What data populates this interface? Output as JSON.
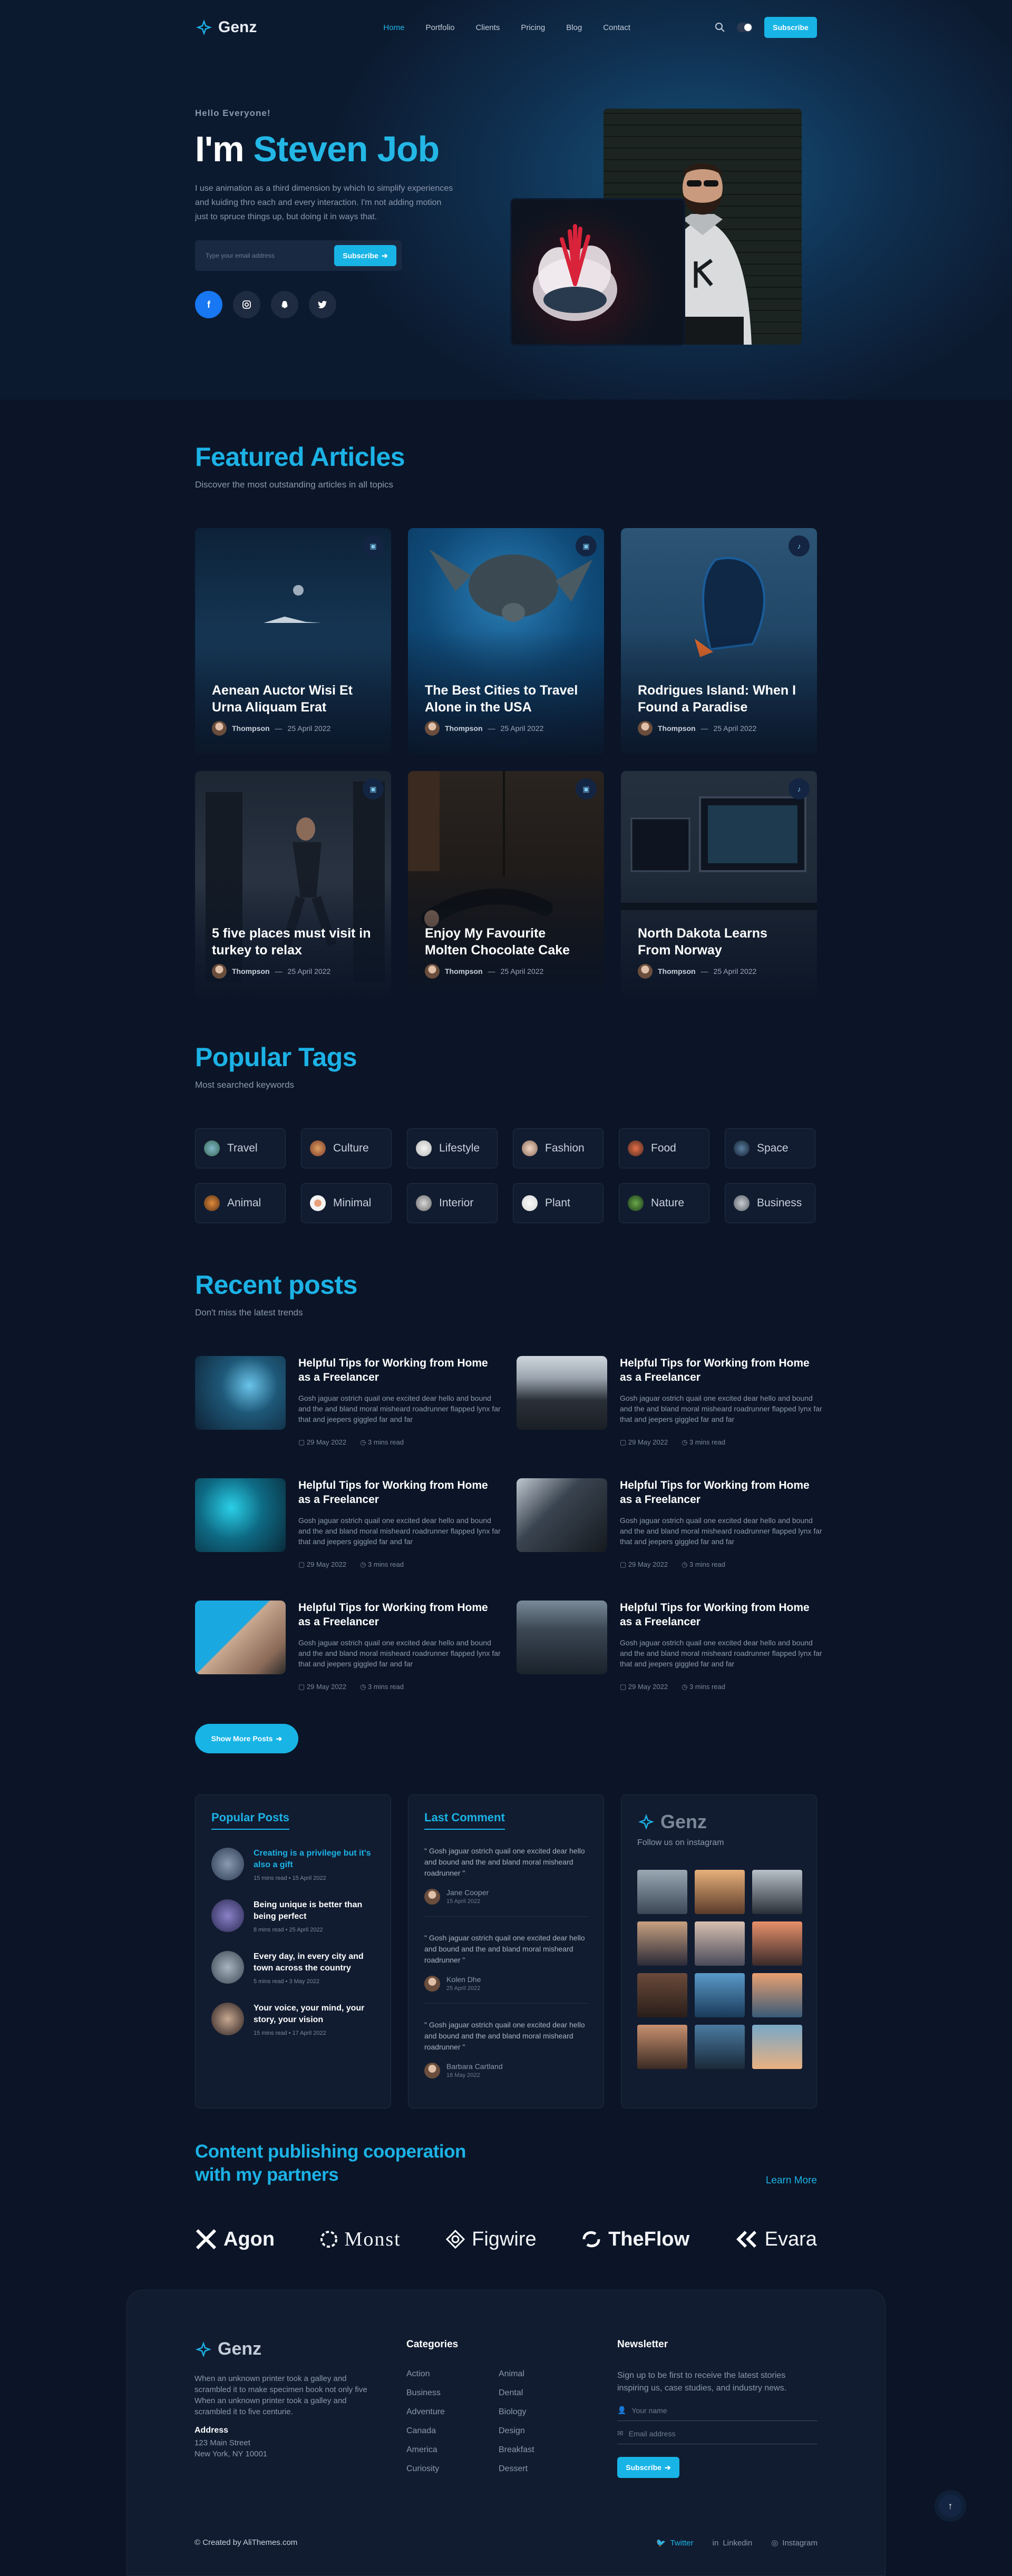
{
  "nav": {
    "logo": "Genz",
    "items": [
      "Home",
      "Portfolio",
      "Clients",
      "Pricing",
      "Blog",
      "Contact"
    ],
    "subscribe": "Subscribe"
  },
  "hero": {
    "hello": "Hello Everyone!",
    "title_pre": "I'm",
    "title_name": "Steven Job",
    "description": "I use animation as a third dimension by which to simplify experiences and kuiding thro each and every interaction. I'm not adding motion just to spruce things up, but doing it in ways that.",
    "email_placeholder": "Type your email address",
    "subscribe": "Subscribe"
  },
  "featured": {
    "title": "Featured Articles",
    "subtitle": "Discover the most outstanding articles in all topics",
    "articles": [
      {
        "title": "Aenean Auctor Wisi Et Urna Aliquam Erat",
        "author": "Thompson",
        "date": "25 April 2022"
      },
      {
        "title": "The Best Cities to Travel Alone in the USA",
        "author": "Thompson",
        "date": "25 April 2022"
      },
      {
        "title": "Rodrigues Island: When I Found a Paradise",
        "author": "Thompson",
        "date": "25 April 2022"
      },
      {
        "title": "5 five places must visit in turkey to relax",
        "author": "Thompson",
        "date": "25 April 2022"
      },
      {
        "title": "Enjoy My Favourite Molten Chocolate Cake",
        "author": "Thompson",
        "date": "25 April 2022"
      },
      {
        "title": "North Dakota Learns From Norway",
        "author": "Thompson",
        "date": "25 April 2022"
      }
    ]
  },
  "tags": {
    "title": "Popular Tags",
    "subtitle": "Most searched keywords",
    "items": [
      "Travel",
      "Culture",
      "Lifestyle",
      "Fashion",
      "Food",
      "Space",
      "Animal",
      "Minimal",
      "Interior",
      "Plant",
      "Nature",
      "Business"
    ]
  },
  "recent": {
    "title": "Recent posts",
    "subtitle": "Don't miss the latest trends",
    "posts": [
      {
        "title": "Helpful Tips for Working from Home as a Freelancer",
        "desc": "Gosh jaguar ostrich quail one excited dear hello and bound and the and bland moral misheard roadrunner flapped lynx far that and jeepers giggled far and far",
        "date": "29 May 2022",
        "read": "3 mins read"
      },
      {
        "title": "Helpful Tips for Working from Home as a Freelancer",
        "desc": "Gosh jaguar ostrich quail one excited dear hello and bound and the and bland moral misheard roadrunner flapped lynx far that and jeepers giggled far and far",
        "date": "29 May 2022",
        "read": "3 mins read"
      },
      {
        "title": "Helpful Tips for Working from Home as a Freelancer",
        "desc": "Gosh jaguar ostrich quail one excited dear hello and bound and the and bland moral misheard roadrunner flapped lynx far that and jeepers giggled far and far",
        "date": "29 May 2022",
        "read": "3 mins read"
      },
      {
        "title": "Helpful Tips for Working from Home as a Freelancer",
        "desc": "Gosh jaguar ostrich quail one excited dear hello and bound and the and bland moral misheard roadrunner flapped lynx far that and jeepers giggled far and far",
        "date": "29 May 2022",
        "read": "3 mins read"
      },
      {
        "title": "Helpful Tips for Working from Home as a Freelancer",
        "desc": "Gosh jaguar ostrich quail one excited dear hello and bound and the and bland moral misheard roadrunner flapped lynx far that and jeepers giggled far and far",
        "date": "29 May 2022",
        "read": "3 mins read"
      },
      {
        "title": "Helpful Tips for Working from Home as a Freelancer",
        "desc": "Gosh jaguar ostrich quail one excited dear hello and bound and the and bland moral misheard roadrunner flapped lynx far that and jeepers giggled far and far",
        "date": "29 May 2022",
        "read": "3 mins read"
      }
    ],
    "show_more": "Show More Posts"
  },
  "popular_posts": {
    "title": "Popular Posts",
    "items": [
      {
        "title": "Creating is a privilege but it's also a gift",
        "read": "15 mins read",
        "date": "15 April 2022"
      },
      {
        "title": "Being unique is better than being perfect",
        "read": "8 mins read",
        "date": "25 April 2022"
      },
      {
        "title": "Every day, in every city and town across the country",
        "read": "5 mins read",
        "date": "3 May 2022"
      },
      {
        "title": "Your voice, your mind, your story, your vision",
        "read": "15 mins read",
        "date": "17 April 2022"
      }
    ]
  },
  "last_comment": {
    "title": "Last Comment",
    "items": [
      {
        "text": "\" Gosh jaguar ostrich quail one excited dear hello and bound and the and bland moral misheard roadrunner \"",
        "name": "Jane Cooper",
        "date": "15 April 2022"
      },
      {
        "text": "\" Gosh jaguar ostrich quail one excited dear hello and bound and the and bland moral misheard roadrunner \"",
        "name": "Kolen Dhe",
        "date": "25 April 2022"
      },
      {
        "text": "\" Gosh jaguar ostrich quail one excited dear hello and bound and the and bland moral misheard roadrunner \"",
        "name": "Barbara Cartland",
        "date": "18 May 2022"
      }
    ]
  },
  "instagram": {
    "logo": "Genz",
    "subtitle": "Follow us on instagram"
  },
  "partners": {
    "title_line1": "Content publishing cooperation",
    "title_line2": "with my partners",
    "learn_more": "Learn More",
    "logos": [
      "Agon",
      "Monst",
      "Figwire",
      "TheFlow",
      "Evara"
    ]
  },
  "footer": {
    "logo": "Genz",
    "about": "When an unknown printer took a galley and scrambled it to make specimen book not only five When an unknown printer took a galley and scrambled it to five centurie.",
    "address_label": "Address",
    "address_line1": "123 Main Street",
    "address_line2": "New York, NY 10001",
    "categories_title": "Categories",
    "categories": [
      "Action",
      "Animal",
      "Business",
      "Dental",
      "Adventure",
      "Biology",
      "Canada",
      "Design",
      "America",
      "Breakfast",
      "Curiosity",
      "Dessert"
    ],
    "newsletter_title": "Newsletter",
    "newsletter_desc": "Sign up to be first to receive the latest stories inspiring us, case studies, and industry news.",
    "name_placeholder": "Your name",
    "email_placeholder": "Email address",
    "subscribe": "Subscribe",
    "copyright": "© Created by AliThemes.com",
    "social": [
      "Twitter",
      "Linkedin",
      "Instagram"
    ]
  },
  "colors": {
    "accent": "#18b4e6",
    "background": "#0b1527",
    "panel": "#111c30"
  }
}
